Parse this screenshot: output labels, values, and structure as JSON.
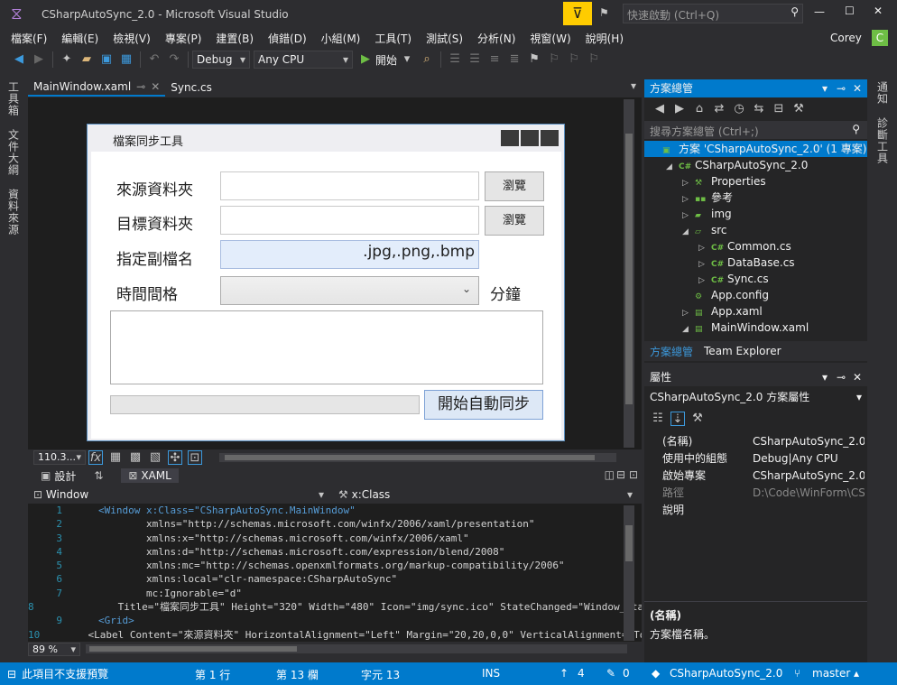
{
  "window": {
    "title": "CSharpAutoSync_2.0 - Microsoft Visual Studio",
    "quick_launch_placeholder": "快速啟動 (Ctrl+Q)",
    "user": "Corey",
    "user_initial": "C"
  },
  "menu": [
    "檔案(F)",
    "編輯(E)",
    "檢視(V)",
    "專案(P)",
    "建置(B)",
    "偵錯(D)",
    "小組(M)",
    "工具(T)",
    "測試(S)",
    "分析(N)",
    "視窗(W)",
    "說明(H)"
  ],
  "toolbar": {
    "config": "Debug",
    "platform": "Any CPU",
    "start_label": "開始"
  },
  "left_strip": [
    "工具箱",
    "文件大綱",
    "資料來源"
  ],
  "right_strip": [
    "通知",
    "診斷工具"
  ],
  "doc_tabs": [
    {
      "label": "MainWindow.xaml",
      "active": true
    },
    {
      "label": "Sync.cs",
      "active": false
    }
  ],
  "wpf_window": {
    "title": "檔案同步工具",
    "source_label": "來源資料夾",
    "target_label": "目標資料夾",
    "ext_label": "指定副檔名",
    "ext_value": ".jpg,.png,.bmp",
    "interval_label": "時間間格",
    "interval_unit": "分鐘",
    "browse_label": "瀏覽",
    "start_sync_label": "開始自動同步"
  },
  "design_bar": {
    "zoom": "110.3..."
  },
  "split_bar": {
    "design_tab": "設計",
    "xaml_tab": "XAML"
  },
  "nav_bar": {
    "left": "Window",
    "right": "x:Class"
  },
  "code_lines": [
    {
      "n": "1",
      "t": "<Window x:Class=\"CSharpAutoSync.MainWindow\""
    },
    {
      "n": "2",
      "t": "        xmlns=\"http://schemas.microsoft.com/winfx/2006/xaml/presentation\""
    },
    {
      "n": "3",
      "t": "        xmlns:x=\"http://schemas.microsoft.com/winfx/2006/xaml\""
    },
    {
      "n": "4",
      "t": "        xmlns:d=\"http://schemas.microsoft.com/expression/blend/2008\""
    },
    {
      "n": "5",
      "t": "        xmlns:mc=\"http://schemas.openxmlformats.org/markup-compatibility/2006\""
    },
    {
      "n": "6",
      "t": "        xmlns:local=\"clr-namespace:CSharpAutoSync\""
    },
    {
      "n": "7",
      "t": "        mc:Ignorable=\"d\""
    },
    {
      "n": "8",
      "t": "        Title=\"檔案同步工具\" Height=\"320\" Width=\"480\" Icon=\"img/sync.ico\" StateChanged=\"Window_State"
    },
    {
      "n": "9",
      "t": "<Grid>"
    },
    {
      "n": "10",
      "t": "  <Label Content=\"來源資料夾\" HorizontalAlignment=\"Left\" Margin=\"20,20,0,0\" VerticalAlignment=\"Top"
    }
  ],
  "code_zoom": "89 %",
  "solution": {
    "title": "方案總管",
    "search_placeholder": "搜尋方案總管 (Ctrl+;)",
    "items": [
      {
        "label": "方案 'CSharpAutoSync_2.0' (1 專案)",
        "indent": 0,
        "icon": "solution-icon",
        "selected": true,
        "arrow": ""
      },
      {
        "label": "CSharpAutoSync_2.0",
        "indent": 1,
        "icon": "csharp-project-icon",
        "arrow": "◢"
      },
      {
        "label": "Properties",
        "indent": 2,
        "icon": "wrench-icon",
        "arrow": "▷"
      },
      {
        "label": "參考",
        "indent": 2,
        "icon": "references-icon",
        "arrow": "▷"
      },
      {
        "label": "img",
        "indent": 2,
        "icon": "folder-icon",
        "arrow": "▷"
      },
      {
        "label": "src",
        "indent": 2,
        "icon": "folder-open-icon",
        "arrow": "◢"
      },
      {
        "label": "Common.cs",
        "indent": 3,
        "icon": "csharp-file-icon",
        "arrow": "▷"
      },
      {
        "label": "DataBase.cs",
        "indent": 3,
        "icon": "csharp-file-icon",
        "arrow": "▷"
      },
      {
        "label": "Sync.cs",
        "indent": 3,
        "icon": "csharp-file-icon",
        "arrow": "▷"
      },
      {
        "label": "App.config",
        "indent": 2,
        "icon": "config-file-icon",
        "arrow": ""
      },
      {
        "label": "App.xaml",
        "indent": 2,
        "icon": "xaml-file-icon",
        "arrow": "▷"
      },
      {
        "label": "MainWindow.xaml",
        "indent": 2,
        "icon": "xaml-file-icon",
        "arrow": "◢"
      }
    ],
    "bottom_tabs": [
      "方案總管",
      "Team Explorer"
    ]
  },
  "properties": {
    "title": "屬性",
    "object": "CSharpAutoSync_2.0  方案屬性",
    "rows": [
      {
        "k": "(名稱)",
        "v": "CSharpAutoSync_2.0"
      },
      {
        "k": "使用中的組態",
        "v": "Debug|Any CPU"
      },
      {
        "k": "啟始專案",
        "v": "CSharpAutoSync_2.0"
      },
      {
        "k": "路徑",
        "v": "D:\\Code\\WinForm\\CS"
      },
      {
        "k": "說明",
        "v": ""
      }
    ],
    "desc_title": "(名稱)",
    "desc_text": "方案檔名稱。"
  },
  "status": {
    "message": "此項目不支援預覽",
    "line": "第 1 行",
    "col": "第 13 欄",
    "char": "字元 13",
    "mode": "INS",
    "up": "4",
    "edits": "0",
    "repo": "CSharpAutoSync_2.0",
    "branch": "master"
  },
  "colors": {
    "accent": "#007acc",
    "toolbar_bg": "#2d2d30",
    "editor_bg": "#1e1e1e",
    "filter_yellow": "#ffcc00"
  }
}
